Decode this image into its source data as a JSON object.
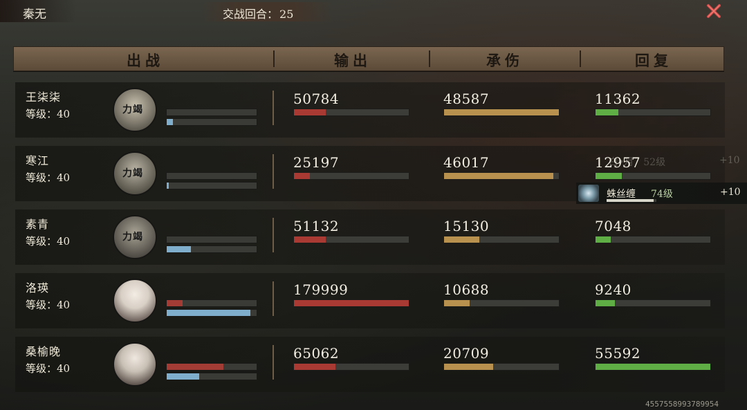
{
  "top": {
    "character_name": "秦无",
    "round_label": "交战回合：",
    "round_value": "25"
  },
  "header": {
    "col_fighter": "出战",
    "col_output": "输出",
    "col_damage_taken": "承伤",
    "col_heal": "回复"
  },
  "rows": [
    {
      "name": "王柒柒",
      "level": "等级：40",
      "stamp": "力竭",
      "mini_red": 0.0,
      "mini_blue": 0.07,
      "output": "50784",
      "output_frac": 0.28,
      "tank": "48587",
      "tank_frac": 1.0,
      "heal": "11362",
      "heal_frac": 0.2
    },
    {
      "name": "寒江",
      "level": "等级：40",
      "stamp": "力竭",
      "mini_red": 0.0,
      "mini_blue": 0.02,
      "output": "25197",
      "output_frac": 0.14,
      "tank": "46017",
      "tank_frac": 0.95,
      "heal": "12957",
      "heal_frac": 0.23
    },
    {
      "name": "素青",
      "level": "等级：40",
      "stamp": "力竭",
      "mini_red": 0.0,
      "mini_blue": 0.27,
      "output": "51132",
      "output_frac": 0.28,
      "tank": "15130",
      "tank_frac": 0.31,
      "heal": "7048",
      "heal_frac": 0.13
    },
    {
      "name": "洛瑛",
      "level": "等级：40",
      "stamp": "",
      "mini_red": 0.18,
      "mini_blue": 0.93,
      "output": "179999",
      "output_frac": 1.0,
      "tank": "10688",
      "tank_frac": 0.22,
      "heal": "9240",
      "heal_frac": 0.17
    },
    {
      "name": "桑榆晚",
      "level": "等级：40",
      "stamp": "",
      "mini_red": 0.63,
      "mini_blue": 0.36,
      "output": "65062",
      "output_frac": 0.36,
      "tank": "20709",
      "tank_frac": 0.43,
      "heal": "55592",
      "heal_frac": 1.0
    }
  ],
  "buff": {
    "name": "蛛丝缠",
    "level": "74级",
    "value": "+10",
    "bar_frac": 0.95,
    "icon": "spider-web-skill-icon"
  },
  "ghost": {
    "text": "白•月　52级",
    "value": "+10"
  },
  "footer_id": "4557558993789954",
  "colors": {
    "output": "#a83a33",
    "tank": "#b8914f",
    "heal": "#5fae45",
    "mini_blue": "#7eaecb",
    "header_bg": "#6e5a46",
    "close": "#d24a4a"
  }
}
